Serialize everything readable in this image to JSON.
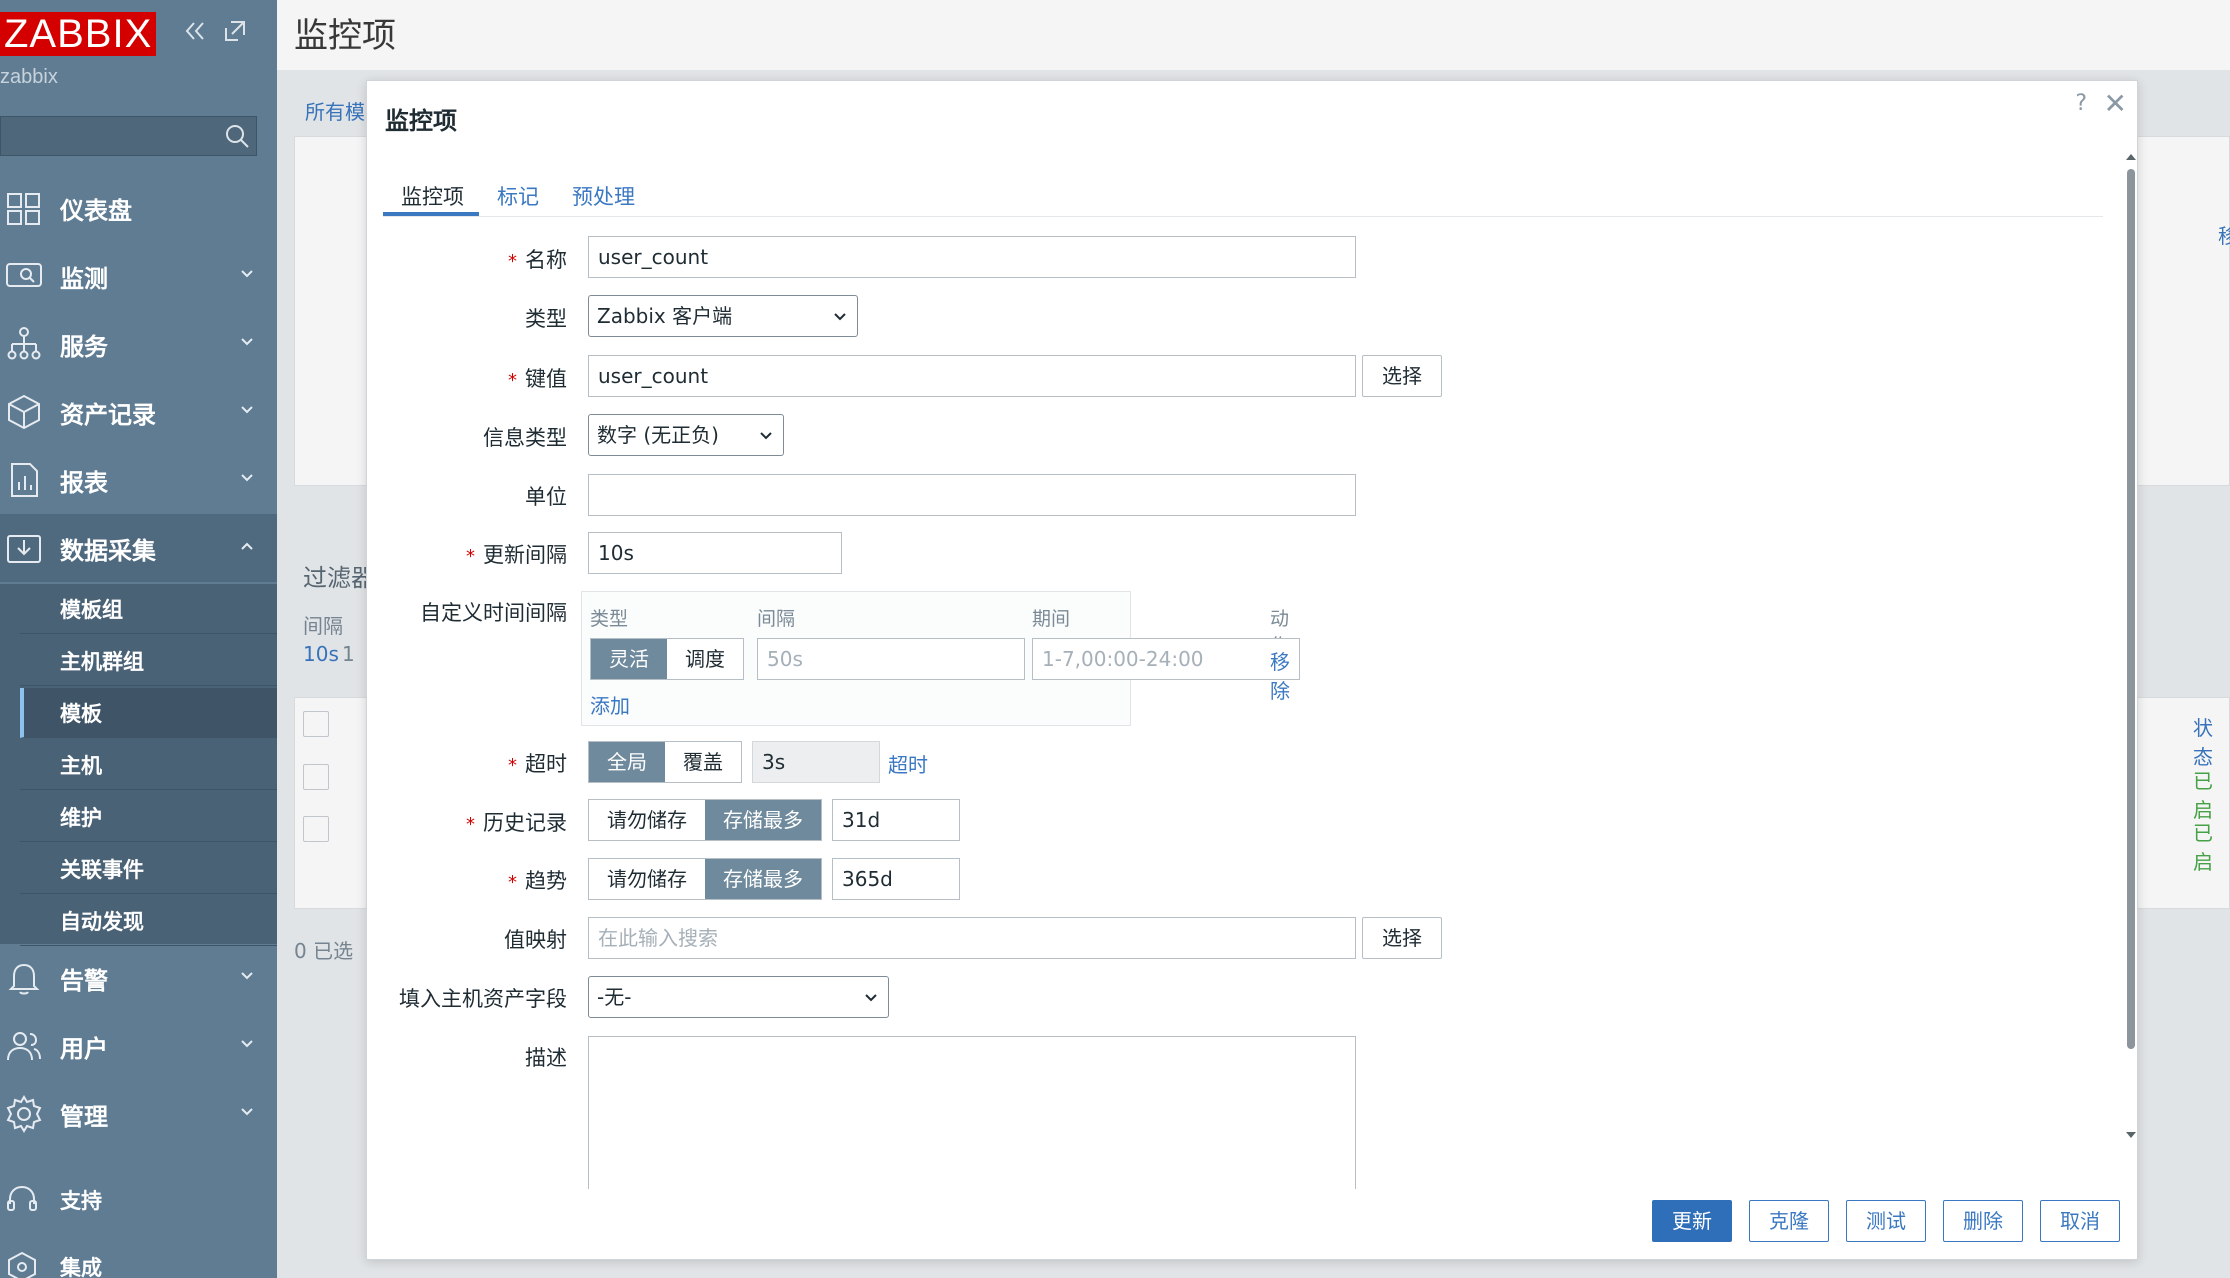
{
  "app": {
    "logo": "ZABBIX",
    "server": "zabbix",
    "collapse_icon": "double-chevron-left-icon",
    "popout_icon": "popout-icon"
  },
  "page": {
    "title": "监控项"
  },
  "sidebar": {
    "items": [
      {
        "label": "仪表盘",
        "icon": "dashboard-icon"
      },
      {
        "label": "监测",
        "icon": "monitoring-icon"
      },
      {
        "label": "服务",
        "icon": "services-icon"
      },
      {
        "label": "资产记录",
        "icon": "inventory-icon"
      },
      {
        "label": "报表",
        "icon": "reports-icon"
      },
      {
        "label": "数据采集",
        "icon": "data-collection-icon"
      }
    ],
    "submenu": [
      "模板组",
      "主机群组",
      "模板",
      "主机",
      "维护",
      "关联事件",
      "自动发现"
    ],
    "lower_items": [
      {
        "label": "告警",
        "icon": "bell-icon"
      },
      {
        "label": "用户",
        "icon": "users-icon"
      },
      {
        "label": "管理",
        "icon": "gear-icon"
      }
    ],
    "bottom_items": [
      {
        "label": "支持",
        "icon": "headset-icon"
      },
      {
        "label": "集成",
        "icon": "integrations-icon"
      }
    ]
  },
  "background": {
    "breadcrumb": "所有模",
    "filter": "过滤器",
    "interval_label": "间隔",
    "interval_value": "10s",
    "interval_extra": "1",
    "selected": "0 已选",
    "status_header": "状态",
    "status_1": "已启",
    "status_2": "已启",
    "right_link": "移"
  },
  "dialog": {
    "title": "监控项",
    "help": "?",
    "close": "✕",
    "tabs": [
      "监控项",
      "标记",
      "预处理"
    ],
    "fields": {
      "name": {
        "label": "名称",
        "value": "user_count"
      },
      "type": {
        "label": "类型",
        "value": "Zabbix 客户端"
      },
      "key": {
        "label": "键值",
        "value": "user_count",
        "button": "选择"
      },
      "info_type": {
        "label": "信息类型",
        "value": "数字 (无正负)"
      },
      "units": {
        "label": "单位",
        "value": ""
      },
      "update_interval": {
        "label": "更新间隔",
        "value": "10s"
      },
      "custom_intervals": {
        "label": "自定义时间间隔",
        "headers": {
          "type": "类型",
          "interval": "间隔",
          "period": "期间",
          "action": "动作"
        },
        "row": {
          "flexible": "灵活",
          "scheduling": "调度",
          "interval_placeholder": "50s",
          "period_placeholder": "1-7,00:00-24:00",
          "remove": "移除"
        },
        "add": "添加"
      },
      "timeout": {
        "label": "超时",
        "global": "全局",
        "override": "覆盖",
        "value": "3s",
        "link": "超时"
      },
      "history": {
        "label": "历史记录",
        "off": "请勿储存",
        "on": "存储最多",
        "value": "31d"
      },
      "trends": {
        "label": "趋势",
        "off": "请勿储存",
        "on": "存储最多",
        "value": "365d"
      },
      "value_map": {
        "label": "值映射",
        "placeholder": "在此输入搜索",
        "button": "选择"
      },
      "inventory": {
        "label": "填入主机资产字段",
        "value": "-无-"
      },
      "description": {
        "label": "描述",
        "value": ""
      }
    },
    "footer": {
      "update": "更新",
      "clone": "克隆",
      "test": "测试",
      "delete": "删除",
      "cancel": "取消"
    }
  }
}
